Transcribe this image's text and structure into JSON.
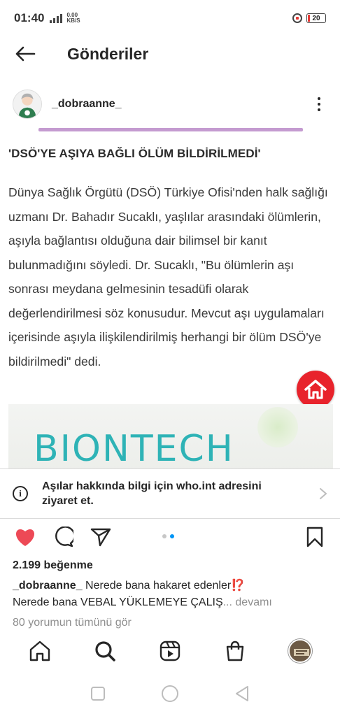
{
  "status_bar": {
    "time": "01:40",
    "network_speed_value": "0.00",
    "network_speed_unit": "KB/S",
    "battery": "20"
  },
  "nav": {
    "title": "Gönderiler",
    "back_icon": "arrow-left-icon"
  },
  "post": {
    "username": "_dobraanne_",
    "heading": "'DSÖ'YE AŞIYA BAĞLI ÖLÜM BİLDİRİLMEDİ'",
    "body": "Dünya Sağlık Örgütü (DSÖ) Türkiye Ofisi'nden halk sağlığı uzmanı Dr. Bahadır Sucaklı, yaşlılar arasındaki ölümlerin, aşıyla bağlantısı olduğuna dair bilimsel bir kanıt bulunmadığını söyledi. Dr. Sucaklı, \"Bu ölümlerin aşı sonrası meydana gelmesinin tesadüfi olarak değerlendirilmesi söz konusudur. Mevcut aşı uygulamaları içerisinde aşıyla ilişkilendirilmiş herhangi bir ölüm DSÖ'ye bildirilmedi\" dedi.",
    "image_text": "BIONTECH"
  },
  "info_banner": {
    "text": "Aşılar hakkında bilgi için who.int adresini ziyaret et."
  },
  "engagement": {
    "likes": "2.199 beğenme",
    "caption_user": "_dobraanne_",
    "caption_line1": " Nerede bana hakaret edenler⁉️",
    "caption_line2": "Nerede bana VEBAL YÜKLEMEYE ÇALIŞ",
    "caption_more": "... devamı",
    "comments": "80 yorumun tümünü gör"
  },
  "carousel": {
    "current": 2,
    "total": 2
  },
  "colors": {
    "heart": "#ed4956",
    "accent_blue": "#0095f6",
    "home_badge": "#e8232c",
    "divider_purple": "#c49bd0",
    "biontech_teal": "#2eb3b6"
  },
  "tabs": [
    "home-icon",
    "search-icon",
    "reels-icon",
    "shop-icon",
    "profile-icon"
  ],
  "system_nav": [
    "recents-square-icon",
    "home-circle-icon",
    "back-triangle-icon"
  ]
}
